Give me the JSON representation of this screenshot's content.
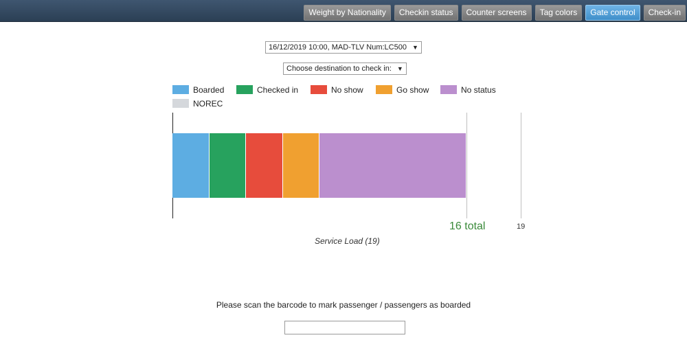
{
  "nav": {
    "tabs": [
      {
        "label": "Weight by Nationality",
        "active": false
      },
      {
        "label": "Checkin status",
        "active": false
      },
      {
        "label": "Counter screens",
        "active": false
      },
      {
        "label": "Tag colors",
        "active": false
      },
      {
        "label": "Gate control",
        "active": true
      },
      {
        "label": "Check-in",
        "active": false
      }
    ]
  },
  "flight_select": {
    "value": "16/12/2019 10:00, MAD-TLV Num:LC500"
  },
  "destination_select": {
    "value": "Choose destination to check in:"
  },
  "legend": [
    {
      "label": "Boarded",
      "color": "#5dade2"
    },
    {
      "label": "Checked in",
      "color": "#27a25e"
    },
    {
      "label": "No show",
      "color": "#e74c3c"
    },
    {
      "label": "Go show",
      "color": "#f0a030"
    },
    {
      "label": "No status",
      "color": "#bb8fce"
    },
    {
      "label": "NOREC",
      "color": "#d5d8dc"
    }
  ],
  "chart_data": {
    "type": "bar",
    "orientation": "horizontal-stacked",
    "series": [
      {
        "name": "Boarded",
        "value": 2
      },
      {
        "name": "Checked in",
        "value": 2
      },
      {
        "name": "No show",
        "value": 2
      },
      {
        "name": "Go show",
        "value": 2
      },
      {
        "name": "No status",
        "value": 8
      },
      {
        "name": "NOREC",
        "value": 0
      }
    ],
    "total": 16,
    "capacity": 19,
    "total_label": "16 total",
    "capacity_label": "19",
    "xlabel": "Service Load (19)"
  },
  "scan": {
    "prompt": "Please scan the barcode to mark passenger / passengers as boarded",
    "value": ""
  }
}
